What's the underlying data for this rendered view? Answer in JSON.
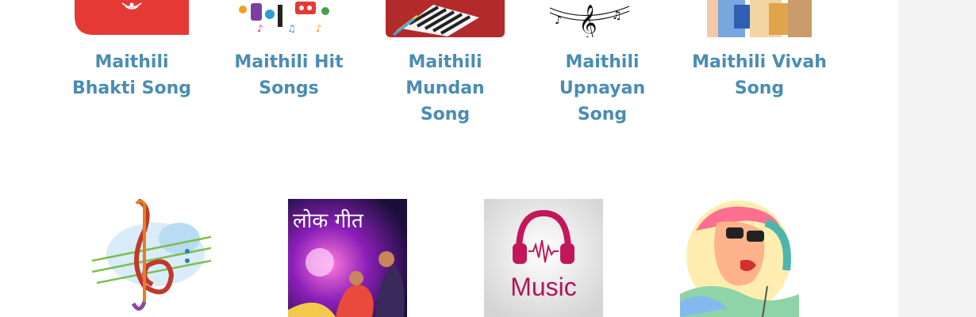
{
  "categories_row1": [
    {
      "label_line1": "Maithili",
      "label_line2": "Bhakti Song",
      "label_line3": "",
      "icon": "bhakti-thumb-icon"
    },
    {
      "label_line1": "Maithili Hit",
      "label_line2": "Songs",
      "label_line3": "",
      "icon": "hit-songs-thumb-icon"
    },
    {
      "label_line1": "Maithili",
      "label_line2": "Mundan",
      "label_line3": "Song",
      "icon": "piano-thumb-icon"
    },
    {
      "label_line1": "Maithili",
      "label_line2": "Upnayan",
      "label_line3": "Song",
      "icon": "music-notes-thumb-icon"
    },
    {
      "label_line1": "Maithili Vivah",
      "label_line2": "Song",
      "label_line3": "",
      "icon": "vivah-thumb-icon"
    }
  ],
  "categories_row2": [
    {
      "icon": "treble-clef-thumb-icon"
    },
    {
      "icon": "lok-geet-thumb-icon",
      "image_text": "लोक गीत"
    },
    {
      "icon": "music-headphones-thumb-icon",
      "image_text": "Music"
    },
    {
      "icon": "dj-thumb-icon"
    }
  ],
  "colors": {
    "label": "#4a8db2",
    "rail": "#f4f4f4"
  }
}
